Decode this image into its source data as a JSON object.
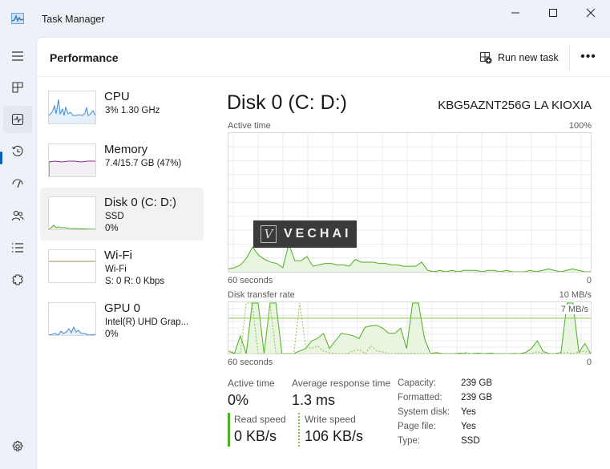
{
  "window": {
    "title": "Task Manager",
    "icon": "task-manager-icon"
  },
  "window_controls": {
    "minimize": "minimize-icon",
    "maximize": "maximize-icon",
    "close": "close-icon"
  },
  "nav": {
    "items": [
      {
        "name": "hamburger-menu",
        "icon": "hamburger-icon"
      },
      {
        "name": "processes",
        "icon": "processes-icon"
      },
      {
        "name": "performance",
        "icon": "performance-icon",
        "active": true
      },
      {
        "name": "app-history",
        "icon": "history-icon"
      },
      {
        "name": "startup-apps",
        "icon": "startup-icon"
      },
      {
        "name": "users",
        "icon": "users-icon"
      },
      {
        "name": "details",
        "icon": "details-icon"
      },
      {
        "name": "services",
        "icon": "services-icon"
      },
      {
        "name": "settings",
        "icon": "gear-icon"
      }
    ]
  },
  "header": {
    "title": "Performance",
    "run_new_task": "Run new task",
    "more": "•••"
  },
  "devices": [
    {
      "name": "CPU",
      "line1": "3% 1.30 GHz",
      "line2": "",
      "color": "#3c8ad0",
      "selected": false
    },
    {
      "name": "Memory",
      "line1": "7.4/15.7 GB (47%)",
      "line2": "",
      "color": "#8b2a8d",
      "selected": false
    },
    {
      "name": "Disk 0 (C: D:)",
      "line1": "SSD",
      "line2": "0%",
      "color": "#4caf20",
      "selected": true
    },
    {
      "name": "Wi-Fi",
      "line1": "Wi-Fi",
      "line2": "S: 0 R: 0 Kbps",
      "color": "#a08a5a",
      "selected": false
    },
    {
      "name": "GPU 0",
      "line1": "Intel(R) UHD Grap...",
      "line2": "0%",
      "color": "#3c8ad0",
      "selected": false
    }
  ],
  "main": {
    "title": "Disk 0 (C: D:)",
    "model": "KBG5AZNT256G LA KIOXIA",
    "active_chart": {
      "label": "Active time",
      "max_label": "100%",
      "time_label": "60 seconds",
      "min_label": "0",
      "values_pct": [
        2,
        3,
        5,
        10,
        18,
        12,
        9,
        7,
        6,
        3,
        20,
        8,
        8,
        11,
        4,
        5,
        6,
        6,
        5,
        5,
        4,
        9,
        7,
        7,
        7,
        6,
        6,
        5,
        5,
        4,
        4,
        4,
        7,
        1,
        0,
        1,
        0,
        1,
        0,
        1,
        1,
        1,
        0,
        1,
        1,
        0,
        1,
        0,
        0,
        0,
        1,
        0,
        1,
        2,
        1,
        0,
        1,
        2,
        1,
        0,
        0
      ]
    },
    "transfer_chart": {
      "label": "Disk transfer rate",
      "max_label": "10 MB/s",
      "line_label": "7 MB/s",
      "time_label": "60 seconds",
      "min_label": "0",
      "max_mb": 10,
      "reference_mb": 7,
      "read_mb": [
        0.5,
        0,
        3.5,
        0,
        10,
        10,
        0,
        10,
        10,
        0,
        0,
        0,
        0.5,
        1,
        2.5,
        3,
        4,
        1,
        2.5,
        4,
        3.8,
        3.5,
        3,
        5.2,
        5.5,
        5.6,
        5,
        4,
        4,
        5,
        1,
        10,
        10,
        3,
        0,
        0.2,
        0,
        0,
        0,
        0.1,
        0,
        0,
        0.1,
        0,
        0.1,
        0,
        0,
        0,
        0,
        0,
        0.2,
        1,
        2.5,
        0.4,
        0,
        0,
        0.2,
        10,
        10,
        0.2,
        2,
        0
      ],
      "write_mb": [
        0.5,
        0.2,
        0,
        10,
        10,
        0,
        0,
        10,
        0,
        0,
        0,
        0,
        10,
        1.5,
        1,
        1.5,
        0.5,
        0.2,
        0,
        0,
        0,
        0.5,
        0.8,
        0,
        1.5,
        0.5,
        0.3,
        0,
        0,
        0.1,
        0,
        0.1,
        0,
        0,
        0,
        0,
        0,
        0,
        0,
        0,
        0.2,
        0,
        0,
        0,
        0,
        0,
        0,
        0,
        0.1,
        0,
        0,
        0,
        0.4,
        0,
        0,
        0,
        0.1,
        0.2,
        0,
        0.3,
        0.5,
        0
      ]
    },
    "stats": {
      "active_time": {
        "label": "Active time",
        "value": "0%"
      },
      "avg_response": {
        "label": "Average response time",
        "value": "1.3 ms"
      },
      "read_speed": {
        "label": "Read speed",
        "value": "0 KB/s"
      },
      "write_speed": {
        "label": "Write speed",
        "value": "106 KB/s"
      }
    },
    "properties": [
      {
        "key": "Capacity:",
        "value": "239 GB"
      },
      {
        "key": "Formatted:",
        "value": "239 GB"
      },
      {
        "key": "System disk:",
        "value": "Yes"
      },
      {
        "key": "Page file:",
        "value": "Yes"
      },
      {
        "key": "Type:",
        "value": "SSD"
      }
    ]
  },
  "watermark": {
    "logo": "V",
    "text": "VECHAI"
  },
  "colors": {
    "disk": "#4caf20",
    "disk_fill": "#e9f5e1",
    "accent": "#005fb8"
  }
}
